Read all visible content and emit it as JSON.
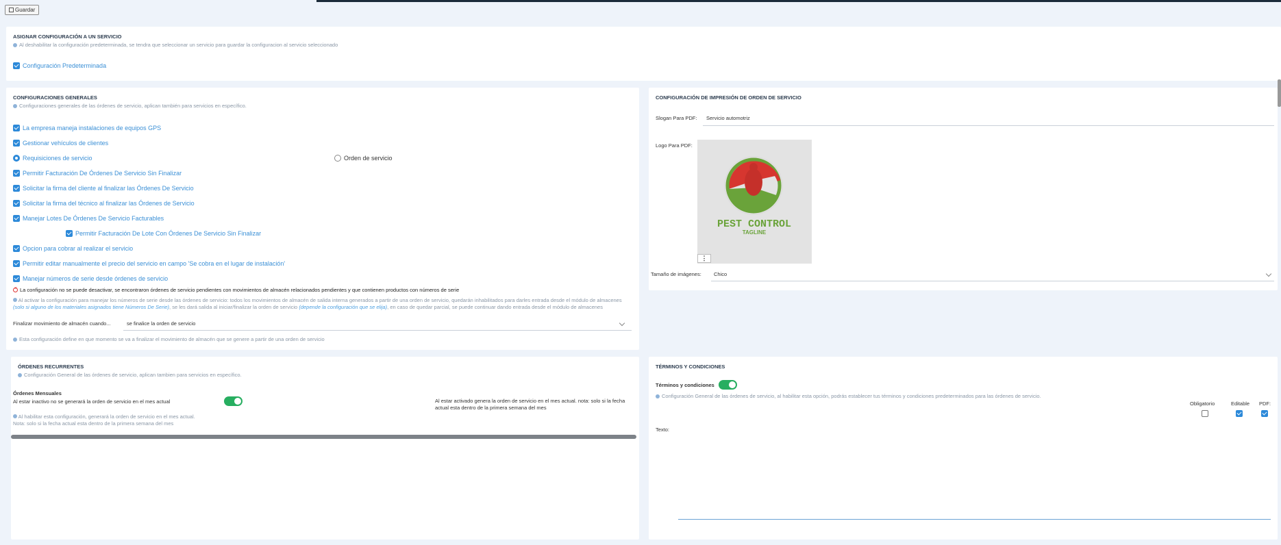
{
  "toolbar": {
    "save_label": "Guardar"
  },
  "assign": {
    "title": "ASIGNAR CONFIGURACIÓN A UN SERVICIO",
    "hint": "Al deshabilitar la configuración predeterminada, se tendra que seleccionar un servicio para guardar la configuracion al servicio seleccionado",
    "default_label": "Configuración Predeterminada"
  },
  "general": {
    "title": "CONFIGURACIONES GENERALES",
    "hint": "Configuraciones generales de las órdenes de servicio, aplican también para servicios en específico.",
    "opt_gps": "La empresa maneja instalaciones de equipos GPS",
    "opt_vehicles": "Gestionar vehículos de clientes",
    "radio_requisitions": "Requisiciones de servicio",
    "radio_orders": "Orden de servicio",
    "opt_invoice_unfinished": "Permitir Facturación De Órdenes De Servicio Sin Finalizar",
    "opt_client_sign": "Solicitar la firma del cliente al finalizar las Órdenes De Servicio",
    "opt_tech_sign": "Solicitar la firma del técnico al finalizar las Órdenes de Servicio",
    "opt_batches": "Manejar Lotes De Órdenes De Servicio Facturables",
    "opt_batch_unfinished": "Permitir Facturación De Lote Con Órdenes De Servicio Sin Finalizar",
    "opt_charge": "Opcion para cobrar al realizar el servicio",
    "opt_edit_price": "Permitir editar manualmente el precio del servicio en campo 'Se cobra en el lugar de instalación'",
    "opt_serials": "Manejar números de serie desde órdenes de servicio",
    "error": "La configuración no se puede desactivar, se encontraron órdenes de servicio pendientes con movimientos de almacén relacionados pendientes y que contienen productos con números de serie",
    "serial_note_1": "Al activar la configuración para manejar los números de serie desde las órdenes de servicio: todos los movimientos de almacén de salida interna generados a partir de una orden de servicio, quedarán inhabilitados para darles entrada desde el módulo de almacenes",
    "serial_note_italic_1": "(solo si alguno de los materiales asignados tiene Números De Serie)",
    "serial_note_2": ", se les dará salida al iniciar/finalizar la orden de servicio",
    "serial_note_italic_2": "(depende la configuración que se elija)",
    "serial_note_3": ", en caso de quedar parcial, se puede continuar dando entrada desde el módulo de almacenes",
    "warehouse_label": "Finalizar movimiento de almacén cuando...",
    "warehouse_value": "se finalice la orden de servicio",
    "warehouse_hint": "Esta configuración define en que momento se va a finalizar el movimiento de almacén que se genere a partir de una orden de servicio"
  },
  "print": {
    "title": "CONFIGURACIÓN DE IMPRESIÓN DE ORDEN DE SERVICIO",
    "slogan_label": "Slogan Para PDF:",
    "slogan_value": "Servicio automotriz",
    "logo_label": "Logo Para PDF:",
    "logo_text_main": "PEST CONTROL",
    "logo_text_sub": "TAGLINE",
    "image_size_label": "Tamaño de imágenes:",
    "image_size_value": "Chico"
  },
  "recurring": {
    "title": "ÓRDENES RECURRENTES",
    "hint": "Configuración General de las órdenes de servicio, aplican tambien para servicios en específico.",
    "monthly_title": "Órdenes Mensuales",
    "inactive_text": "Al estar inactivo no se generará la orden de servicio en el mes actual",
    "active_text": "Al estar activado genera la orden de servicio en el mes actual. nota: solo si la fecha actual esta dentro de la primera semana del mes",
    "note_line1": "Al habilitar esta configuración, generará la orden de servicio en el mes actual.",
    "note_line2": "Nota: solo si la fecha actual esta dentro de la primera semana del mes"
  },
  "terms": {
    "title": "TÉRMINOS Y CONDICIONES",
    "toggle_label": "Términos y condiciones",
    "hint": "Configuración General de las órdenes de servicio, al habilitar esta opción, podrás establecer tus términos y condiciones predeterminados para las órdenes de servicio.",
    "col_required": "Obligatorio",
    "col_editable": "Editable",
    "col_pdf": "PDF:",
    "text_label": "Texto:"
  },
  "colors": {
    "accent": "#2c89d9",
    "toggle_on": "#27ae60",
    "error": "#dd3333"
  }
}
